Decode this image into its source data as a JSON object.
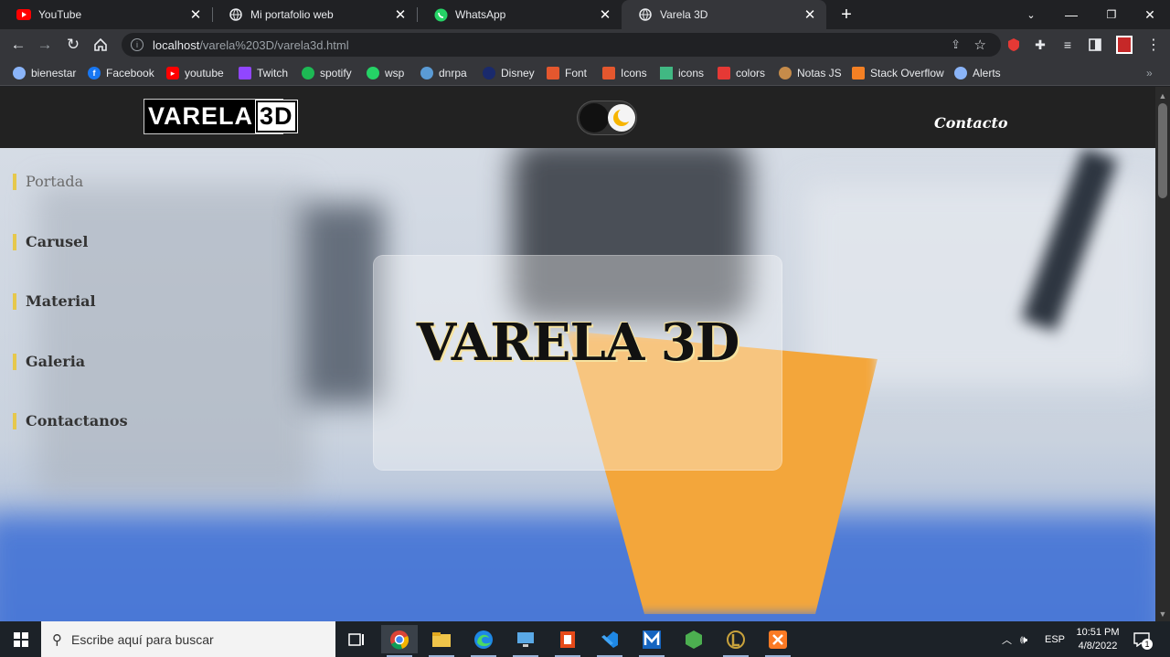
{
  "browser": {
    "tabs": [
      {
        "title": "YouTube",
        "icon": "youtube-icon"
      },
      {
        "title": "Mi portafolio web",
        "icon": "globe-icon"
      },
      {
        "title": "WhatsApp",
        "icon": "whatsapp-icon"
      },
      {
        "title": "Varela 3D",
        "icon": "globe-icon",
        "active": true
      }
    ],
    "address": {
      "host": "localhost",
      "path": "/varela%203D/varela3d.html"
    },
    "bookmarks": [
      {
        "label": "bienestar",
        "color": "#8ab4f8"
      },
      {
        "label": "Facebook",
        "color": "#1877f2"
      },
      {
        "label": "youtube",
        "color": "#ff0000"
      },
      {
        "label": "Twitch",
        "color": "#9146ff"
      },
      {
        "label": "spotify",
        "color": "#1db954"
      },
      {
        "label": "wsp",
        "color": "#25d366"
      },
      {
        "label": "dnrpa",
        "color": "#5a9bd5"
      },
      {
        "label": "Disney",
        "color": "#1a2a6c"
      },
      {
        "label": "Font",
        "color": "#e4572e"
      },
      {
        "label": "Icons",
        "color": "#e4572e"
      },
      {
        "label": "icons",
        "color": "#41b883"
      },
      {
        "label": "colors",
        "color": "#e53935"
      },
      {
        "label": "Notas JS",
        "color": "#c58b4a"
      },
      {
        "label": "Stack Overflow",
        "color": "#f48024"
      },
      {
        "label": "Alerts",
        "color": "#8ab4f8"
      }
    ]
  },
  "site": {
    "logo": {
      "text": "VARELA",
      "box": "3D"
    },
    "contact_link": "Contacto",
    "sidenav": [
      "Portada",
      "Carusel",
      "Material",
      "Galeria",
      "Contactanos"
    ],
    "hero_title": "VARELA 3D",
    "accent": "#e6c84c"
  },
  "taskbar": {
    "search_placeholder": "Escribe aquí para buscar",
    "language": "ESP",
    "time": "10:51 PM",
    "date": "4/8/2022",
    "notification_count": "1"
  }
}
